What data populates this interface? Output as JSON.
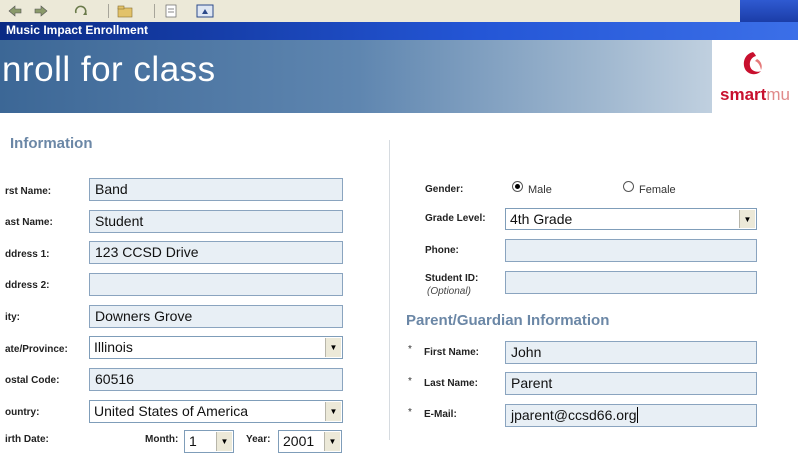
{
  "window": {
    "title": "Music Impact Enrollment"
  },
  "banner": {
    "heading": "nroll for class",
    "logo_main": "smart",
    "logo_suffix": "mu"
  },
  "left": {
    "section_title": "Information",
    "labels": {
      "first_name": "rst Name:",
      "last_name": "ast Name:",
      "address1": "ddress 1:",
      "address2": "ddress 2:",
      "city": "ity:",
      "state": "ate/Province:",
      "postal": "ostal Code:",
      "country": "ountry:",
      "birth": "irth Date:"
    },
    "values": {
      "first_name": "Band",
      "last_name": "Student",
      "address1": "123 CCSD Drive",
      "address2": "",
      "city": "Downers Grove",
      "state": "Illinois",
      "postal": "60516",
      "country": "United States of America"
    },
    "birth": {
      "month_label": "Month:",
      "month_value": "1",
      "year_label": "Year:",
      "year_value": "2001"
    }
  },
  "right": {
    "gender_label": "Gender:",
    "gender_options": [
      "Male",
      "Female"
    ],
    "gender_selected": "Male",
    "grade_label": "Grade Level:",
    "grade_value": "4th Grade",
    "phone_label": "Phone:",
    "phone_value": "",
    "student_id_label": "Student ID:",
    "student_id_hint": "(Optional)",
    "student_id_value": "",
    "parent_section_title": "Parent/Guardian Information",
    "required_marker": "*",
    "parent_first_label": "First Name:",
    "parent_first_value": "John",
    "parent_last_label": "Last Name:",
    "parent_last_value": "Parent",
    "parent_email_label": "E-Mail:",
    "parent_email_value": "jparent@ccsd66.org"
  },
  "icons": [
    "back-icon",
    "forward-icon",
    "refresh-icon",
    "folder-icon",
    "page-icon",
    "window-icon",
    "dropdown-arrow-icon",
    "radio-icon",
    "logo-icon"
  ],
  "colors": {
    "title_bar": "#0a2a84",
    "banner_start": "#3c6796",
    "section_heading": "#6b87a6",
    "field_bg": "#e8eff5",
    "logo_red": "#c8102e"
  }
}
